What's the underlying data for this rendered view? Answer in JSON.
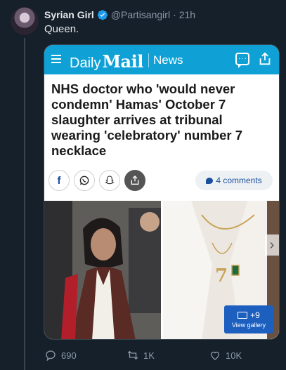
{
  "author": {
    "name": "Syrian Girl",
    "handle": "@Partisangirl",
    "separator": "·",
    "time": "21h",
    "verified": true
  },
  "tweet": {
    "text": "Queen."
  },
  "card": {
    "brand": {
      "daily": "Daily",
      "mail": "Mail",
      "section": "News"
    },
    "headline": "NHS doctor who 'would never condemn' Hamas' October 7 slaughter arrives at tribunal wearing 'celebratory' number 7 necklace",
    "share_buttons": [
      "facebook-icon",
      "whatsapp-icon",
      "snapchat-icon",
      "share-icon"
    ],
    "comments_label": "4 comments",
    "gallery": {
      "count": "+9",
      "label": "View gallery"
    }
  },
  "actions": {
    "replies": "690",
    "reposts": "1K",
    "likes": "10K"
  },
  "colors": {
    "background": "#15202b",
    "dailymail_bar": "#0fa1d6",
    "verified": "#1d9bf0",
    "muted": "#8b98a5",
    "gallery_badge": "#1d5fbf"
  }
}
